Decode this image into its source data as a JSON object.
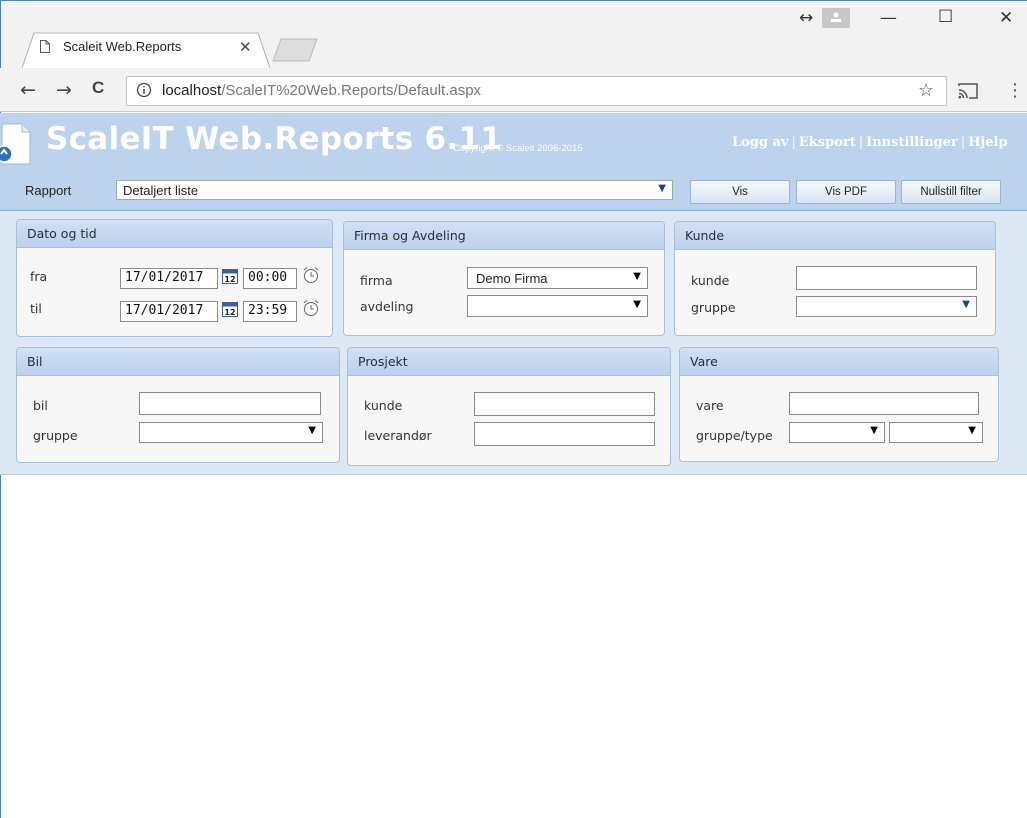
{
  "browser": {
    "tab_title": "Scaleit Web.Reports",
    "tab_close": "✕",
    "url_host": "localhost",
    "url_path": "/ScaleIT%20Web.Reports/Default.aspx",
    "nav": {
      "back": "←",
      "forward": "→",
      "reload": "C"
    },
    "window_controls": {
      "resize": "↔",
      "minimize": "—",
      "maximize": "☐",
      "close": "✕"
    },
    "star": "☆",
    "menu": "⋮"
  },
  "app": {
    "title": "ScaleIT Web.Reports 6.11",
    "copyright": "Copyright © Scaleit 2006-2015",
    "links": [
      "Logg av",
      "Eksport",
      "Innstillinger",
      "Hjelp"
    ],
    "link_separator": "|"
  },
  "report_bar": {
    "label": "Rapport",
    "selected": "Detaljert liste",
    "buttons": {
      "vis": "Vis",
      "vis_pdf": "Vis PDF",
      "reset": "Nullstill filter"
    }
  },
  "panels": {
    "dato": {
      "title": "Dato og tid",
      "fra_label": "fra",
      "til_label": "til",
      "fra_date": "17/01/2017",
      "fra_time": "00:00",
      "til_date": "17/01/2017",
      "til_time": "23:59"
    },
    "firma": {
      "title": "Firma og Avdeling",
      "firma_label": "firma",
      "firma_value": "Demo Firma",
      "avdeling_label": "avdeling",
      "avdeling_value": ""
    },
    "kunde": {
      "title": "Kunde",
      "kunde_label": "kunde",
      "kunde_value": "",
      "gruppe_label": "gruppe",
      "gruppe_value": ""
    },
    "bil": {
      "title": "Bil",
      "bil_label": "bil",
      "bil_value": "",
      "gruppe_label": "gruppe",
      "gruppe_value": ""
    },
    "prosjekt": {
      "title": "Prosjekt",
      "kunde_label": "kunde",
      "kunde_value": "",
      "leverandor_label": "leverandør",
      "leverandor_value": ""
    },
    "vare": {
      "title": "Vare",
      "vare_label": "vare",
      "vare_value": "",
      "gruppe_label": "gruppe/type",
      "gruppe_value": "",
      "type_value": ""
    }
  },
  "icons": {
    "calendar": "calendar-icon",
    "clock": "alarm-clock-icon",
    "dropdown": "chevron-down-icon"
  },
  "colors": {
    "header_bg": "#bcd2ed",
    "panel_border": "#a7bedc",
    "window_border": "#4f7fc0"
  }
}
